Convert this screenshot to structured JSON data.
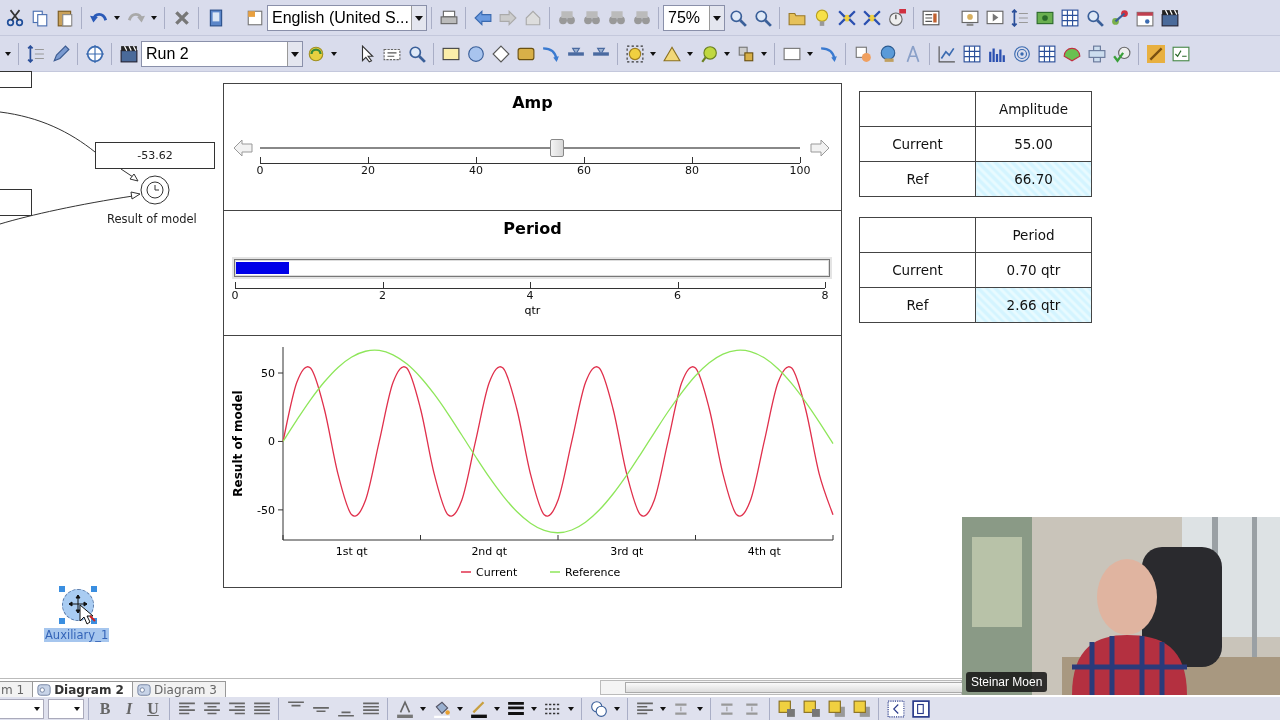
{
  "toolbar": {
    "language_select": {
      "value": "English (United S..."
    },
    "zoom_select": {
      "value": "75%"
    },
    "run_select": {
      "value": "Run 2"
    }
  },
  "diagram": {
    "value_box": {
      "value": "-53.62"
    },
    "node_label": "Result of model",
    "auxiliary": {
      "label": "Auxiliary_1",
      "selected": true
    }
  },
  "slider_panel": {
    "title": "Amp",
    "level": 0.55,
    "ticks": [
      "0",
      "20",
      "40",
      "60",
      "80",
      "100"
    ]
  },
  "progress_panel": {
    "title": "Period",
    "level": 0.09,
    "ticks": [
      "0",
      "2",
      "4",
      "6",
      "8"
    ],
    "unit": "qtr"
  },
  "chart_panel": {
    "chart_data": {
      "type": "line",
      "legend": "bottom",
      "ylabel": "Result of model",
      "xlim": [
        0,
        4
      ],
      "ylim": [
        -72,
        69
      ],
      "yticks": [
        -50,
        0,
        50
      ],
      "xticks": [
        {
          "value": 0.5,
          "label": "1st qt"
        },
        {
          "value": 1.5,
          "label": "2nd qt"
        },
        {
          "value": 2.5,
          "label": "3rd qt"
        },
        {
          "value": 3.5,
          "label": "4th qt"
        }
      ],
      "x": [
        0,
        0.1,
        0.2,
        0.3,
        0.4,
        0.5,
        0.6,
        0.7,
        0.8,
        0.9,
        1,
        1.1,
        1.2,
        1.3,
        1.4,
        1.5,
        1.6,
        1.7,
        1.8,
        1.9,
        2,
        2.1,
        2.2,
        2.3,
        2.4,
        2.5,
        2.6,
        2.7,
        2.8,
        2.9,
        3,
        3.1,
        3.2,
        3.3,
        3.4,
        3.5,
        3.6,
        3.7,
        3.8,
        3.9,
        4
      ],
      "series": [
        {
          "name": "Current",
          "color": "#e0304c",
          "values": [
            0,
            43,
            53.6,
            23.9,
            -23.9,
            -53.6,
            -43,
            0,
            43,
            53.6,
            23.9,
            -23.9,
            -53.6,
            -43,
            0,
            43,
            53.6,
            23.9,
            -23.9,
            -53.6,
            -43,
            0,
            43,
            53.6,
            23.9,
            -23.9,
            -53.6,
            -43,
            0,
            43,
            53.6,
            23.9,
            -23.9,
            -53.6,
            -43,
            0,
            43,
            53.6,
            23.9,
            -23.9,
            -53.6
          ]
        },
        {
          "name": "Reference",
          "color": "#8ee65a",
          "values": [
            0,
            15.6,
            30.4,
            43.4,
            54.1,
            61.7,
            65.9,
            66.5,
            63.3,
            56.7,
            46.9,
            34.5,
            20.2,
            4.7,
            -11,
            -26.1,
            -39.7,
            -51.2,
            -59.7,
            -65,
            -66.7,
            -64.7,
            -59,
            -50.1,
            -38.4,
            -24.6,
            -9.4,
            6.3,
            21.7,
            35.7,
            48,
            57.5,
            63.8,
            66.6,
            65.7,
            61.1,
            53.1,
            42.2,
            28.9,
            14.1,
            -1.6
          ]
        }
      ]
    }
  },
  "tables": [
    {
      "header": "Amplitude",
      "rows": [
        {
          "label": "Current",
          "value": "55.00",
          "editable": false
        },
        {
          "label": "Ref",
          "value": "66.70",
          "editable": true
        }
      ]
    },
    {
      "header": "Period",
      "rows": [
        {
          "label": "Current",
          "value": "0.70 qtr",
          "editable": false
        },
        {
          "label": "Ref",
          "value": "2.66 qtr",
          "editable": true
        }
      ]
    }
  ],
  "tabs": [
    {
      "label": "m 1",
      "selected": false
    },
    {
      "label": "Diagram 2",
      "selected": true
    },
    {
      "label": "Diagram 3",
      "selected": false
    }
  ],
  "format_toolbar": {
    "style_buttons": [
      "B",
      "I",
      "U"
    ]
  },
  "video": {
    "kind": "picture",
    "name": "Steinar Moen"
  }
}
